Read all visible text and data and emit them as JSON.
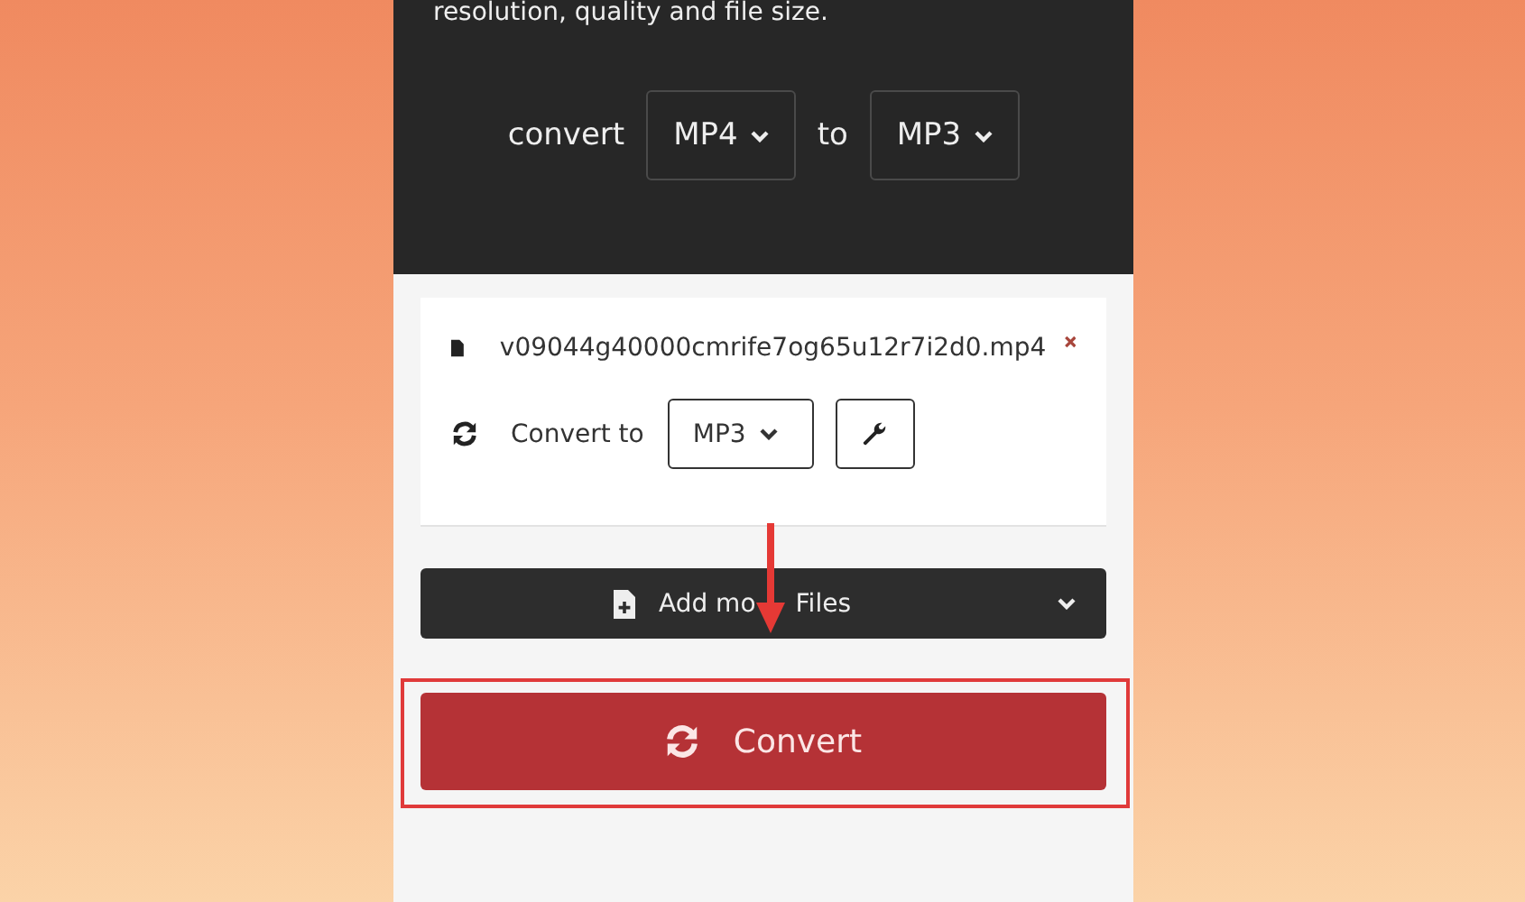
{
  "intro_text": "resolution, quality and file size.",
  "format_picker": {
    "label_convert": "convert",
    "from": "MP4",
    "label_to": "to",
    "to": "MP3"
  },
  "files": [
    {
      "name": "v09044g40000cmrife7og65u12r7i2d0.mp4",
      "convert_label": "Convert to",
      "target": "MP3"
    }
  ],
  "add_files_button": {
    "visible_parts": [
      "Add mo",
      "Files"
    ]
  },
  "convert_button": "Convert",
  "annotations": {
    "arrow": true,
    "highlight_frame": true
  }
}
